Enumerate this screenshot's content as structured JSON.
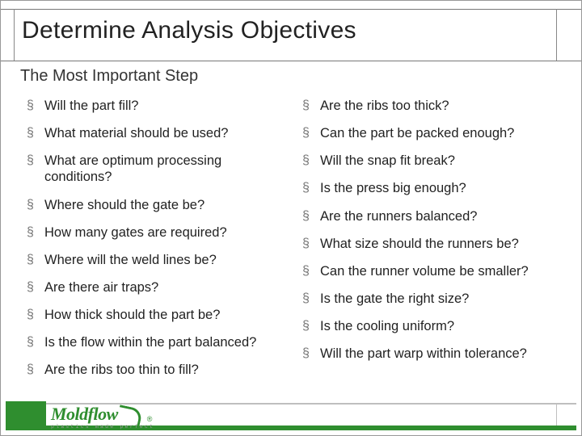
{
  "title": "Determine Analysis Objectives",
  "subtitle": "The Most Important Step",
  "left_bullets": [
    "Will the part fill?",
    "What material should be used?",
    "What are optimum processing conditions?",
    "Where should the gate be?",
    "How many gates are required?",
    "Where will the weld lines be?",
    "Are there air traps?",
    "How thick should the part be?",
    "Is the flow within the part balanced?",
    "Are the ribs too thin to fill?"
  ],
  "right_bullets": [
    "Are the ribs too thick?",
    "Can the part be packed enough?",
    "Will the snap fit break?",
    "Is the press big enough?",
    "Are the runners balanced?",
    "What size should the runners be?",
    "Can the runner volume be smaller?",
    "Is the gate the right size?",
    "Is the cooling uniform?",
    "Will the part warp within tolerance?"
  ],
  "logo": {
    "wordmark": "Moldflow",
    "registered": "®",
    "tagline": "plastics made perfect"
  }
}
